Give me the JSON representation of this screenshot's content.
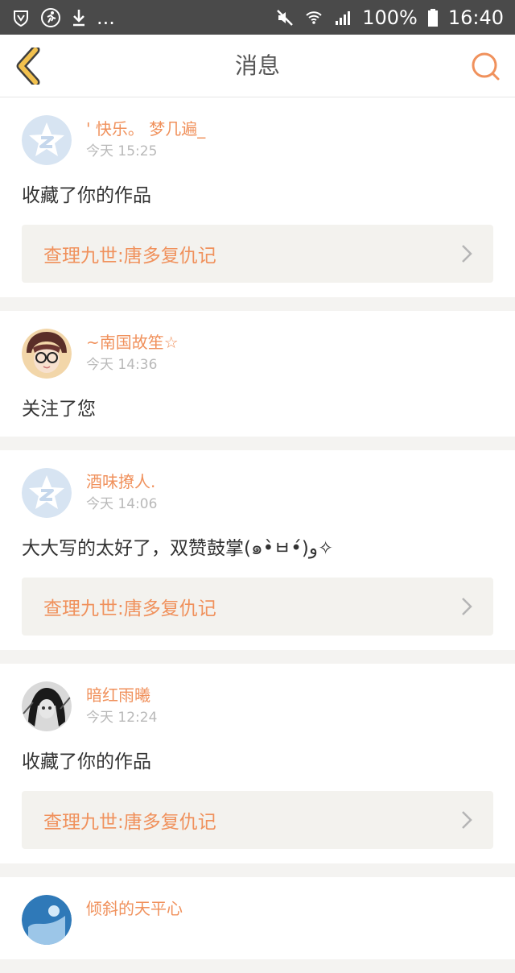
{
  "statusbar": {
    "more": "...",
    "battery_pct": "100%",
    "time": "16:40"
  },
  "nav": {
    "title": "消息"
  },
  "messages": [
    {
      "username": "' 快乐。 梦几遍_",
      "time": "今天 15:25",
      "text": "收藏了你的作品",
      "work": "查理九世:唐多复仇记",
      "avatar": "default-qq-avatar"
    },
    {
      "username": "~南国故笙☆",
      "time": "今天 14:36",
      "text": "关注了您",
      "avatar": "glasses-girl-photo"
    },
    {
      "username": "酒味撩人.",
      "time": "今天 14:06",
      "text": "大大写的太好了，双赞鼓掌(๑•̀ㅂ•́)و✧",
      "work": "查理九世:唐多复仇记",
      "avatar": "default-qq-avatar"
    },
    {
      "username": "暗红雨曦",
      "time": "今天 12:24",
      "text": "收藏了你的作品",
      "work": "查理九世:唐多复仇记",
      "avatar": "dark-anime-photo"
    },
    {
      "username": "倾斜的天平心",
      "avatar": "blue-photo"
    }
  ],
  "colors": {
    "accent": "#f0915c",
    "back_arrow": "#f2c14e"
  }
}
